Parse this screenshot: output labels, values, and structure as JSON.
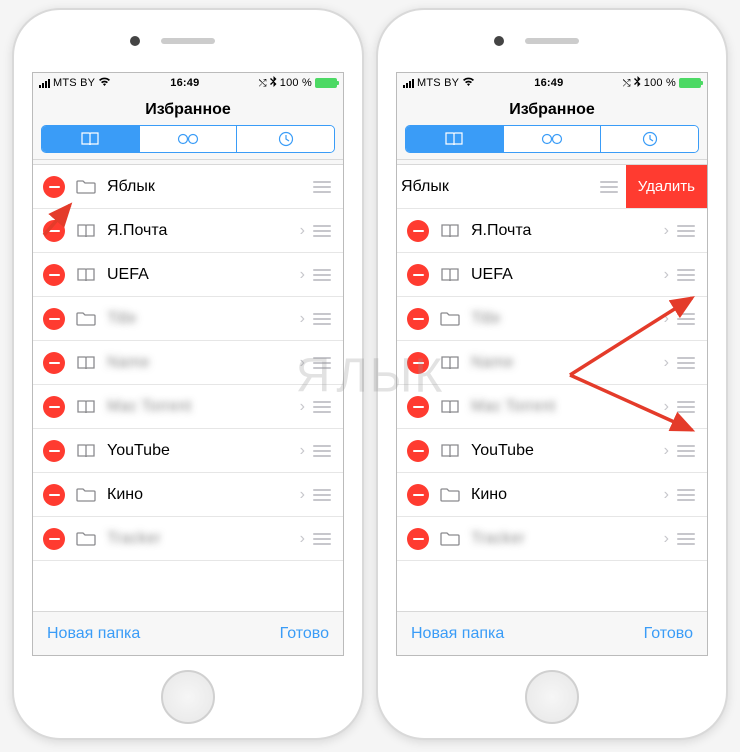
{
  "status_bar": {
    "carrier": "MTS BY",
    "has_wifi": true,
    "time": "16:49",
    "bluetooth": true,
    "battery_text": "100 %"
  },
  "header": {
    "title": "Избранное"
  },
  "segmented": {
    "tabs": [
      "bookmarks",
      "reading-list",
      "history"
    ],
    "selected_index": 0
  },
  "list_items": [
    {
      "label": "Яблык",
      "icon": "folder",
      "has_chevron": false,
      "blurred": false
    },
    {
      "label": "Я.Почта",
      "icon": "bookmark",
      "has_chevron": true,
      "blurred": false
    },
    {
      "label": "UEFA",
      "icon": "bookmark",
      "has_chevron": true,
      "blurred": false
    },
    {
      "label": "Title",
      "icon": "folder",
      "has_chevron": true,
      "blurred": true
    },
    {
      "label": "Name",
      "icon": "bookmark",
      "has_chevron": true,
      "blurred": true
    },
    {
      "label": "Mac Torrent",
      "icon": "bookmark",
      "has_chevron": true,
      "blurred": true
    },
    {
      "label": "YouTube",
      "icon": "bookmark",
      "has_chevron": true,
      "blurred": false
    },
    {
      "label": "Кино",
      "icon": "folder",
      "has_chevron": true,
      "blurred": false
    },
    {
      "label": "Tracker",
      "icon": "folder",
      "has_chevron": true,
      "blurred": true
    }
  ],
  "swipe": {
    "delete_label": "Удалить",
    "swiped_row_index": 0
  },
  "toolbar": {
    "new_folder_label": "Новая папка",
    "done_label": "Готово"
  },
  "watermark_text": "ЯБЛЫК"
}
